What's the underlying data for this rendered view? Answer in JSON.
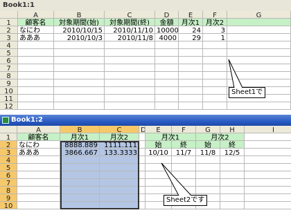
{
  "book1": {
    "title": "Book1:1",
    "columns": [
      "",
      "A",
      "B",
      "C",
      "D",
      "E",
      "F",
      "G"
    ],
    "rows": [
      {
        "n": "1",
        "cells": [
          "顧客名",
          "対象期間(始)",
          "対象期間(終)",
          "金額",
          "月次1",
          "月次2",
          ""
        ]
      },
      {
        "n": "2",
        "cells": [
          "なにわ",
          "2010/10/15",
          "2010/11/10",
          "10000",
          "24",
          "3",
          ""
        ]
      },
      {
        "n": "3",
        "cells": [
          "あああ",
          "2010/10/3",
          "2010/11/8",
          "4000",
          "29",
          "1",
          ""
        ]
      },
      {
        "n": "4",
        "cells": [
          "",
          "",
          "",
          "",
          "",
          "",
          ""
        ]
      },
      {
        "n": "5",
        "cells": [
          "",
          "",
          "",
          "",
          "",
          "",
          ""
        ]
      },
      {
        "n": "6",
        "cells": [
          "",
          "",
          "",
          "",
          "",
          "",
          ""
        ]
      },
      {
        "n": "7",
        "cells": [
          "",
          "",
          "",
          "",
          "",
          "",
          ""
        ]
      },
      {
        "n": "8",
        "cells": [
          "",
          "",
          "",
          "",
          "",
          "",
          ""
        ]
      },
      {
        "n": "9",
        "cells": [
          "",
          "",
          "",
          "",
          "",
          "",
          ""
        ]
      },
      {
        "n": "10",
        "cells": [
          "",
          "",
          "",
          "",
          "",
          "",
          ""
        ]
      },
      {
        "n": "11",
        "cells": [
          "",
          "",
          "",
          "",
          "",
          "",
          ""
        ]
      },
      {
        "n": "12",
        "cells": [
          "",
          "",
          "",
          "",
          "",
          "",
          ""
        ]
      }
    ],
    "callout": "Sheet1で"
  },
  "book2": {
    "title": "Book1:2",
    "columns": [
      "",
      "A",
      "B",
      "C",
      "D",
      "E",
      "F",
      "G",
      "H",
      "I"
    ],
    "row1": {
      "n": "1",
      "a": "顧客名",
      "b": "月次1",
      "c": "月次2",
      "ef": "月次1",
      "gh": "月次2"
    },
    "rows": [
      {
        "n": "2",
        "cells": [
          "なにわ",
          "8888.889",
          "1111.111",
          "",
          "始",
          "終",
          "始",
          "終",
          ""
        ]
      },
      {
        "n": "3",
        "cells": [
          "あああ",
          "3866.667",
          "133.3333",
          "",
          "10/10",
          "11/7",
          "11/8",
          "12/5",
          ""
        ]
      },
      {
        "n": "4",
        "cells": [
          "",
          "",
          "",
          "",
          "",
          "",
          "",
          "",
          ""
        ]
      },
      {
        "n": "5",
        "cells": [
          "",
          "",
          "",
          "",
          "",
          "",
          "",
          "",
          ""
        ]
      },
      {
        "n": "6",
        "cells": [
          "",
          "",
          "",
          "",
          "",
          "",
          "",
          "",
          ""
        ]
      },
      {
        "n": "7",
        "cells": [
          "",
          "",
          "",
          "",
          "",
          "",
          "",
          "",
          ""
        ]
      },
      {
        "n": "8",
        "cells": [
          "",
          "",
          "",
          "",
          "",
          "",
          "",
          "",
          ""
        ]
      },
      {
        "n": "9",
        "cells": [
          "",
          "",
          "",
          "",
          "",
          "",
          "",
          "",
          ""
        ]
      },
      {
        "n": "10",
        "cells": [
          "",
          "",
          "",
          "",
          "",
          "",
          "",
          "",
          ""
        ]
      }
    ],
    "callout": "Sheet2です"
  },
  "colors": {
    "selected_header": "#f6c86a",
    "selection_fill": "#b4c6e4",
    "green_fill": "#c6f0c6",
    "titlebar": "#2a5bc4"
  }
}
